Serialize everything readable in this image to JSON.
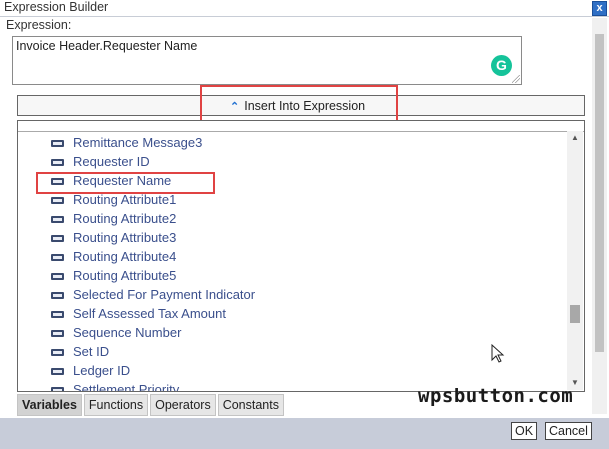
{
  "window": {
    "title": "Expression Builder",
    "close_label": "x"
  },
  "expression": {
    "label": "Expression:",
    "value": "Invoice Header.Requester Name",
    "grammarly_glyph": "G"
  },
  "insert": {
    "label": "Insert Into Expression",
    "icon": "chevron-up-icon"
  },
  "variables": [
    "Remittance Message3",
    "Requester ID",
    "Requester Name",
    "Routing Attribute1",
    "Routing Attribute2",
    "Routing Attribute3",
    "Routing Attribute4",
    "Routing Attribute5",
    "Selected For Payment Indicator",
    "Self Assessed Tax Amount",
    "Sequence Number",
    "Set ID",
    "Ledger ID",
    "Settlement Priority"
  ],
  "tabs": [
    "Variables",
    "Functions",
    "Operators",
    "Constants"
  ],
  "active_tab": "Variables",
  "buttons": {
    "ok": "OK",
    "cancel": "Cancel"
  },
  "watermark": "wpsbutton.com",
  "colors": {
    "highlight": "#e04343",
    "item_text": "#3a4f8c",
    "bottom_bar": "#c7ccd9"
  }
}
